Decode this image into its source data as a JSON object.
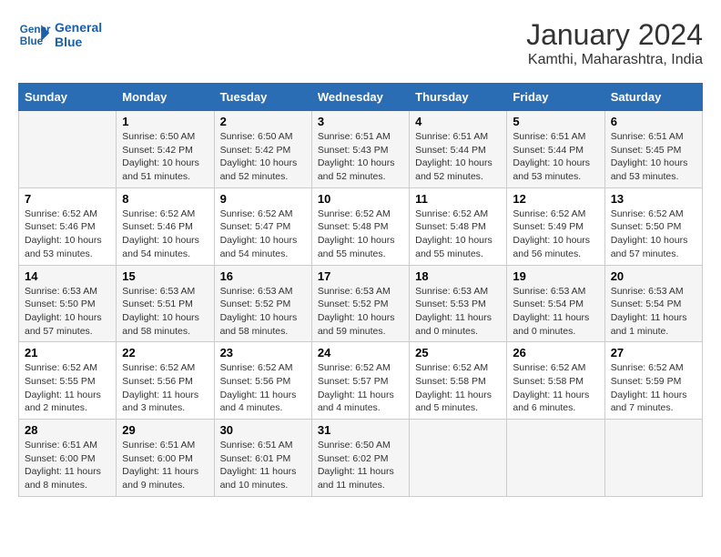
{
  "header": {
    "logo_line1": "General",
    "logo_line2": "Blue",
    "month": "January 2024",
    "location": "Kamthi, Maharashtra, India"
  },
  "weekdays": [
    "Sunday",
    "Monday",
    "Tuesday",
    "Wednesday",
    "Thursday",
    "Friday",
    "Saturday"
  ],
  "weeks": [
    [
      {
        "day": "",
        "detail": ""
      },
      {
        "day": "1",
        "detail": "Sunrise: 6:50 AM\nSunset: 5:42 PM\nDaylight: 10 hours\nand 51 minutes."
      },
      {
        "day": "2",
        "detail": "Sunrise: 6:50 AM\nSunset: 5:42 PM\nDaylight: 10 hours\nand 52 minutes."
      },
      {
        "day": "3",
        "detail": "Sunrise: 6:51 AM\nSunset: 5:43 PM\nDaylight: 10 hours\nand 52 minutes."
      },
      {
        "day": "4",
        "detail": "Sunrise: 6:51 AM\nSunset: 5:44 PM\nDaylight: 10 hours\nand 52 minutes."
      },
      {
        "day": "5",
        "detail": "Sunrise: 6:51 AM\nSunset: 5:44 PM\nDaylight: 10 hours\nand 53 minutes."
      },
      {
        "day": "6",
        "detail": "Sunrise: 6:51 AM\nSunset: 5:45 PM\nDaylight: 10 hours\nand 53 minutes."
      }
    ],
    [
      {
        "day": "7",
        "detail": "Sunrise: 6:52 AM\nSunset: 5:46 PM\nDaylight: 10 hours\nand 53 minutes."
      },
      {
        "day": "8",
        "detail": "Sunrise: 6:52 AM\nSunset: 5:46 PM\nDaylight: 10 hours\nand 54 minutes."
      },
      {
        "day": "9",
        "detail": "Sunrise: 6:52 AM\nSunset: 5:47 PM\nDaylight: 10 hours\nand 54 minutes."
      },
      {
        "day": "10",
        "detail": "Sunrise: 6:52 AM\nSunset: 5:48 PM\nDaylight: 10 hours\nand 55 minutes."
      },
      {
        "day": "11",
        "detail": "Sunrise: 6:52 AM\nSunset: 5:48 PM\nDaylight: 10 hours\nand 55 minutes."
      },
      {
        "day": "12",
        "detail": "Sunrise: 6:52 AM\nSunset: 5:49 PM\nDaylight: 10 hours\nand 56 minutes."
      },
      {
        "day": "13",
        "detail": "Sunrise: 6:52 AM\nSunset: 5:50 PM\nDaylight: 10 hours\nand 57 minutes."
      }
    ],
    [
      {
        "day": "14",
        "detail": "Sunrise: 6:53 AM\nSunset: 5:50 PM\nDaylight: 10 hours\nand 57 minutes."
      },
      {
        "day": "15",
        "detail": "Sunrise: 6:53 AM\nSunset: 5:51 PM\nDaylight: 10 hours\nand 58 minutes."
      },
      {
        "day": "16",
        "detail": "Sunrise: 6:53 AM\nSunset: 5:52 PM\nDaylight: 10 hours\nand 58 minutes."
      },
      {
        "day": "17",
        "detail": "Sunrise: 6:53 AM\nSunset: 5:52 PM\nDaylight: 10 hours\nand 59 minutes."
      },
      {
        "day": "18",
        "detail": "Sunrise: 6:53 AM\nSunset: 5:53 PM\nDaylight: 11 hours\nand 0 minutes."
      },
      {
        "day": "19",
        "detail": "Sunrise: 6:53 AM\nSunset: 5:54 PM\nDaylight: 11 hours\nand 0 minutes."
      },
      {
        "day": "20",
        "detail": "Sunrise: 6:53 AM\nSunset: 5:54 PM\nDaylight: 11 hours\nand 1 minute."
      }
    ],
    [
      {
        "day": "21",
        "detail": "Sunrise: 6:52 AM\nSunset: 5:55 PM\nDaylight: 11 hours\nand 2 minutes."
      },
      {
        "day": "22",
        "detail": "Sunrise: 6:52 AM\nSunset: 5:56 PM\nDaylight: 11 hours\nand 3 minutes."
      },
      {
        "day": "23",
        "detail": "Sunrise: 6:52 AM\nSunset: 5:56 PM\nDaylight: 11 hours\nand 4 minutes."
      },
      {
        "day": "24",
        "detail": "Sunrise: 6:52 AM\nSunset: 5:57 PM\nDaylight: 11 hours\nand 4 minutes."
      },
      {
        "day": "25",
        "detail": "Sunrise: 6:52 AM\nSunset: 5:58 PM\nDaylight: 11 hours\nand 5 minutes."
      },
      {
        "day": "26",
        "detail": "Sunrise: 6:52 AM\nSunset: 5:58 PM\nDaylight: 11 hours\nand 6 minutes."
      },
      {
        "day": "27",
        "detail": "Sunrise: 6:52 AM\nSunset: 5:59 PM\nDaylight: 11 hours\nand 7 minutes."
      }
    ],
    [
      {
        "day": "28",
        "detail": "Sunrise: 6:51 AM\nSunset: 6:00 PM\nDaylight: 11 hours\nand 8 minutes."
      },
      {
        "day": "29",
        "detail": "Sunrise: 6:51 AM\nSunset: 6:00 PM\nDaylight: 11 hours\nand 9 minutes."
      },
      {
        "day": "30",
        "detail": "Sunrise: 6:51 AM\nSunset: 6:01 PM\nDaylight: 11 hours\nand 10 minutes."
      },
      {
        "day": "31",
        "detail": "Sunrise: 6:50 AM\nSunset: 6:02 PM\nDaylight: 11 hours\nand 11 minutes."
      },
      {
        "day": "",
        "detail": ""
      },
      {
        "day": "",
        "detail": ""
      },
      {
        "day": "",
        "detail": ""
      }
    ]
  ]
}
